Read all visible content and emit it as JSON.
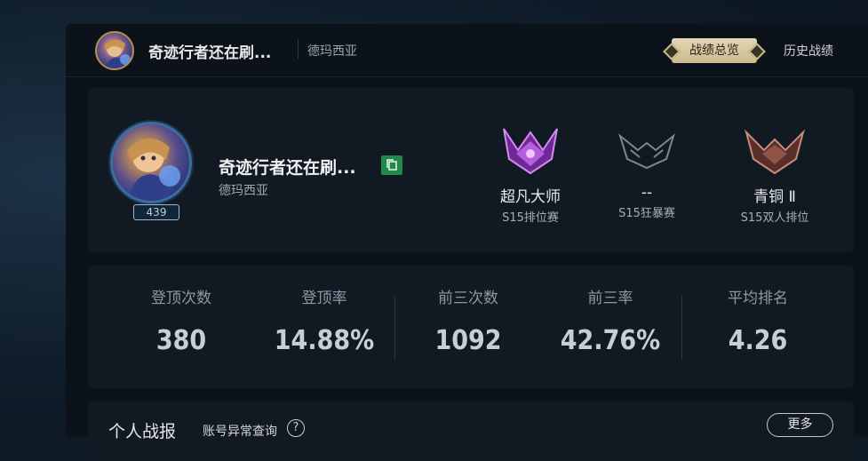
{
  "header": {
    "summoner_name": "奇迹行者还在刷...",
    "server": "德玛西亚",
    "tab_overview": "战绩总览",
    "tab_history": "历史战绩"
  },
  "profile": {
    "name": "奇迹行者还在刷...",
    "server": "德玛西亚",
    "level": "439",
    "ranks": [
      {
        "tier": "超凡大师",
        "mode": "S15排位赛",
        "emblem": "master-emblem-icon",
        "color": "#b05ad6"
      },
      {
        "tier": "--",
        "mode": "S15狂暴赛",
        "emblem": "unranked-emblem-icon",
        "color": "#8a8f95"
      },
      {
        "tier": "青铜 Ⅱ",
        "mode": "S15双人排位",
        "emblem": "bronze-emblem-icon",
        "color": "#a46a5c"
      }
    ]
  },
  "stats": [
    {
      "label": "登顶次数",
      "value": "380"
    },
    {
      "label": "登顶率",
      "value": "14.88%"
    },
    {
      "label": "前三次数",
      "value": "1092"
    },
    {
      "label": "前三率",
      "value": "42.76%"
    },
    {
      "label": "平均排名",
      "value": "4.26"
    }
  ],
  "report": {
    "title": "个人战报",
    "account_check": "账号异常查询",
    "help": "?",
    "more": "更多"
  },
  "colors": {
    "accent_gold": "#cdbb8f",
    "copy_green": "#1f8a4c",
    "panel_bg": "#0b121a",
    "card_bg": "#111a23"
  }
}
